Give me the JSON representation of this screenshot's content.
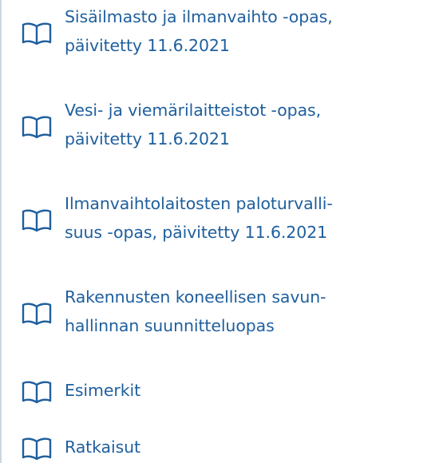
{
  "list": {
    "items": [
      {
        "lines": [
          "Sisäilmasto ja ilmanvaihto -opas,",
          "päivitetty 11.6.2021"
        ],
        "icon": "book-icon"
      },
      {
        "lines": [
          "Vesi- ja viemärilaitteistot -opas,",
          "päivitetty 11.6.2021"
        ],
        "icon": "book-icon"
      },
      {
        "lines": [
          "Ilmanvaihtolaitosten paloturvalli-",
          "suus -opas, päivitetty 11.6.2021"
        ],
        "icon": "book-icon"
      },
      {
        "lines": [
          "Rakennusten koneellisen savun-",
          "hallinnan suunnitteluopas"
        ],
        "icon": "book-icon"
      },
      {
        "lines": [
          "Esimerkit"
        ],
        "icon": "book-icon"
      },
      {
        "lines": [
          "Ratkaisut"
        ],
        "icon": "book-icon"
      }
    ]
  },
  "colors": {
    "link": "#1f5f9e",
    "border": "#cfd6de"
  }
}
